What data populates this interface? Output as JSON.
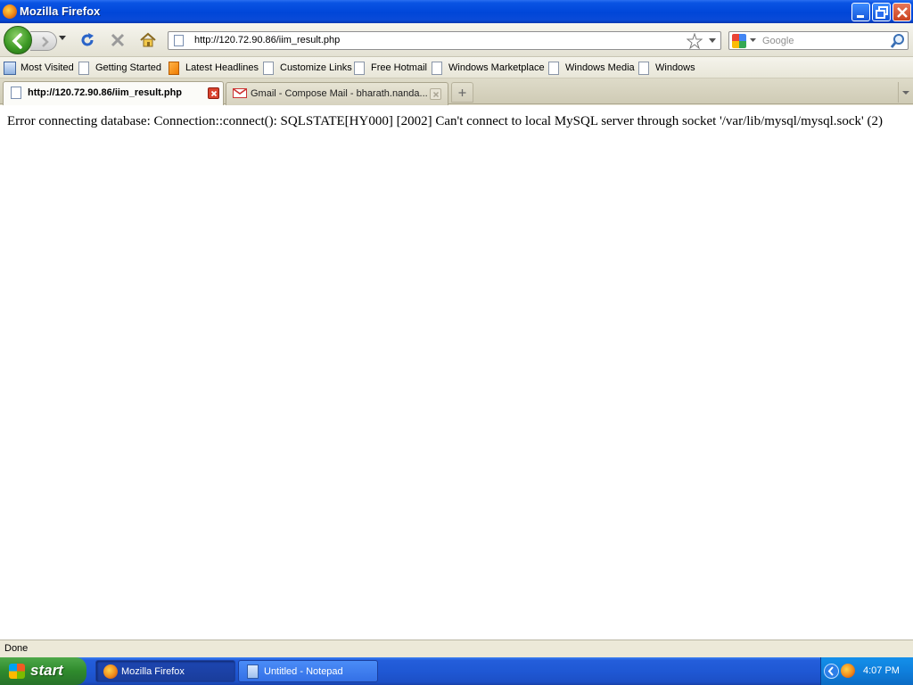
{
  "window": {
    "title": "Mozilla Firefox",
    "icon": "firefox-icon"
  },
  "navbar": {
    "url": "http://120.72.90.86/iim_result.php",
    "search_placeholder": "Google",
    "icons": [
      "back-icon",
      "forward-icon",
      "reload-icon",
      "stop-icon",
      "home-icon",
      "bookmark-star-icon",
      "search-magnifier-icon"
    ]
  },
  "bookmarks": [
    {
      "label": "Most Visited",
      "icon": "most-visited-icon"
    },
    {
      "label": "Getting Started",
      "icon": "page-icon"
    },
    {
      "label": "Latest Headlines",
      "icon": "rss-icon"
    },
    {
      "label": "Customize Links",
      "icon": "page-icon"
    },
    {
      "label": "Free Hotmail",
      "icon": "page-icon"
    },
    {
      "label": "Windows Marketplace",
      "icon": "page-icon"
    },
    {
      "label": "Windows Media",
      "icon": "page-icon"
    },
    {
      "label": "Windows",
      "icon": "page-icon"
    }
  ],
  "tabs": [
    {
      "label": "http://120.72.90.86/iim_result.php",
      "active": true
    },
    {
      "label": "Gmail - Compose Mail - bharath.nanda...",
      "active": false
    }
  ],
  "content": {
    "message": "Error connecting database: Connection::connect(): SQLSTATE[HY000] [2002] Can't connect to local MySQL server through socket '/var/lib/mysql/mysql.sock' (2)"
  },
  "statusbar": {
    "text": "Done"
  },
  "taskbar": {
    "start_label": "start",
    "tasks": [
      {
        "label": "Mozilla Firefox",
        "active": true,
        "icon": "firefox-icon"
      },
      {
        "label": "Untitled - Notepad",
        "active": false,
        "icon": "notepad-icon"
      }
    ],
    "clock": "4:07 PM"
  },
  "colors": {
    "titlebar": "#0046d8",
    "taskbar": "#245edb",
    "start_button": "#2f8a2c",
    "tab_close_active": "#d9432e"
  }
}
